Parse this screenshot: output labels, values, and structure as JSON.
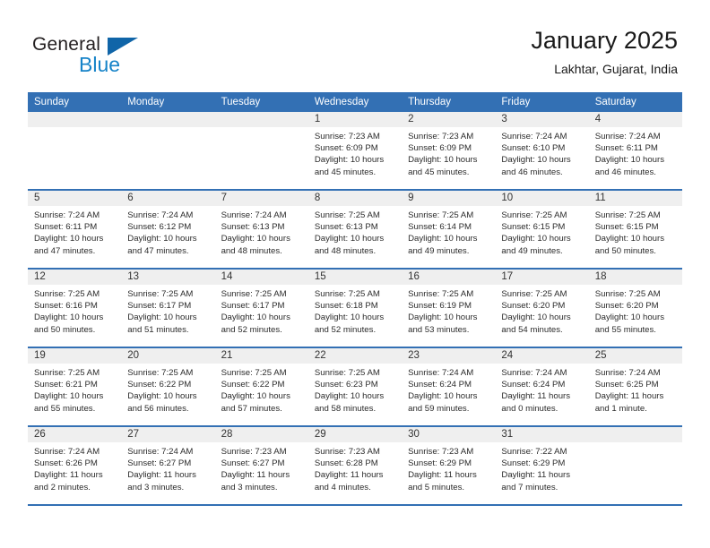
{
  "brand": {
    "name_dark": "General",
    "name_blue": "Blue",
    "color_dark": "#231f20",
    "color_blue": "#1683c8",
    "triangle_color": "#1065a8"
  },
  "header": {
    "title": "January 2025",
    "subtitle": "Lakhtar, Gujarat, India"
  },
  "theme": {
    "header_row_bg": "#3370b4",
    "header_row_text": "#ffffff",
    "daynum_band_bg": "#efefef",
    "row_divider": "#3370b4"
  },
  "calendar": {
    "weekday_headers": [
      "Sunday",
      "Monday",
      "Tuesday",
      "Wednesday",
      "Thursday",
      "Friday",
      "Saturday"
    ],
    "weeks": [
      [
        {
          "day": "",
          "empty": true
        },
        {
          "day": "",
          "empty": true
        },
        {
          "day": "",
          "empty": true
        },
        {
          "day": "1",
          "sunrise": "Sunrise: 7:23 AM",
          "sunset": "Sunset: 6:09 PM",
          "daylight_line1": "Daylight: 10 hours",
          "daylight_line2": "and 45 minutes."
        },
        {
          "day": "2",
          "sunrise": "Sunrise: 7:23 AM",
          "sunset": "Sunset: 6:09 PM",
          "daylight_line1": "Daylight: 10 hours",
          "daylight_line2": "and 45 minutes."
        },
        {
          "day": "3",
          "sunrise": "Sunrise: 7:24 AM",
          "sunset": "Sunset: 6:10 PM",
          "daylight_line1": "Daylight: 10 hours",
          "daylight_line2": "and 46 minutes."
        },
        {
          "day": "4",
          "sunrise": "Sunrise: 7:24 AM",
          "sunset": "Sunset: 6:11 PM",
          "daylight_line1": "Daylight: 10 hours",
          "daylight_line2": "and 46 minutes."
        }
      ],
      [
        {
          "day": "5",
          "sunrise": "Sunrise: 7:24 AM",
          "sunset": "Sunset: 6:11 PM",
          "daylight_line1": "Daylight: 10 hours",
          "daylight_line2": "and 47 minutes."
        },
        {
          "day": "6",
          "sunrise": "Sunrise: 7:24 AM",
          "sunset": "Sunset: 6:12 PM",
          "daylight_line1": "Daylight: 10 hours",
          "daylight_line2": "and 47 minutes."
        },
        {
          "day": "7",
          "sunrise": "Sunrise: 7:24 AM",
          "sunset": "Sunset: 6:13 PM",
          "daylight_line1": "Daylight: 10 hours",
          "daylight_line2": "and 48 minutes."
        },
        {
          "day": "8",
          "sunrise": "Sunrise: 7:25 AM",
          "sunset": "Sunset: 6:13 PM",
          "daylight_line1": "Daylight: 10 hours",
          "daylight_line2": "and 48 minutes."
        },
        {
          "day": "9",
          "sunrise": "Sunrise: 7:25 AM",
          "sunset": "Sunset: 6:14 PM",
          "daylight_line1": "Daylight: 10 hours",
          "daylight_line2": "and 49 minutes."
        },
        {
          "day": "10",
          "sunrise": "Sunrise: 7:25 AM",
          "sunset": "Sunset: 6:15 PM",
          "daylight_line1": "Daylight: 10 hours",
          "daylight_line2": "and 49 minutes."
        },
        {
          "day": "11",
          "sunrise": "Sunrise: 7:25 AM",
          "sunset": "Sunset: 6:15 PM",
          "daylight_line1": "Daylight: 10 hours",
          "daylight_line2": "and 50 minutes."
        }
      ],
      [
        {
          "day": "12",
          "sunrise": "Sunrise: 7:25 AM",
          "sunset": "Sunset: 6:16 PM",
          "daylight_line1": "Daylight: 10 hours",
          "daylight_line2": "and 50 minutes."
        },
        {
          "day": "13",
          "sunrise": "Sunrise: 7:25 AM",
          "sunset": "Sunset: 6:17 PM",
          "daylight_line1": "Daylight: 10 hours",
          "daylight_line2": "and 51 minutes."
        },
        {
          "day": "14",
          "sunrise": "Sunrise: 7:25 AM",
          "sunset": "Sunset: 6:17 PM",
          "daylight_line1": "Daylight: 10 hours",
          "daylight_line2": "and 52 minutes."
        },
        {
          "day": "15",
          "sunrise": "Sunrise: 7:25 AM",
          "sunset": "Sunset: 6:18 PM",
          "daylight_line1": "Daylight: 10 hours",
          "daylight_line2": "and 52 minutes."
        },
        {
          "day": "16",
          "sunrise": "Sunrise: 7:25 AM",
          "sunset": "Sunset: 6:19 PM",
          "daylight_line1": "Daylight: 10 hours",
          "daylight_line2": "and 53 minutes."
        },
        {
          "day": "17",
          "sunrise": "Sunrise: 7:25 AM",
          "sunset": "Sunset: 6:20 PM",
          "daylight_line1": "Daylight: 10 hours",
          "daylight_line2": "and 54 minutes."
        },
        {
          "day": "18",
          "sunrise": "Sunrise: 7:25 AM",
          "sunset": "Sunset: 6:20 PM",
          "daylight_line1": "Daylight: 10 hours",
          "daylight_line2": "and 55 minutes."
        }
      ],
      [
        {
          "day": "19",
          "sunrise": "Sunrise: 7:25 AM",
          "sunset": "Sunset: 6:21 PM",
          "daylight_line1": "Daylight: 10 hours",
          "daylight_line2": "and 55 minutes."
        },
        {
          "day": "20",
          "sunrise": "Sunrise: 7:25 AM",
          "sunset": "Sunset: 6:22 PM",
          "daylight_line1": "Daylight: 10 hours",
          "daylight_line2": "and 56 minutes."
        },
        {
          "day": "21",
          "sunrise": "Sunrise: 7:25 AM",
          "sunset": "Sunset: 6:22 PM",
          "daylight_line1": "Daylight: 10 hours",
          "daylight_line2": "and 57 minutes."
        },
        {
          "day": "22",
          "sunrise": "Sunrise: 7:25 AM",
          "sunset": "Sunset: 6:23 PM",
          "daylight_line1": "Daylight: 10 hours",
          "daylight_line2": "and 58 minutes."
        },
        {
          "day": "23",
          "sunrise": "Sunrise: 7:24 AM",
          "sunset": "Sunset: 6:24 PM",
          "daylight_line1": "Daylight: 10 hours",
          "daylight_line2": "and 59 minutes."
        },
        {
          "day": "24",
          "sunrise": "Sunrise: 7:24 AM",
          "sunset": "Sunset: 6:24 PM",
          "daylight_line1": "Daylight: 11 hours",
          "daylight_line2": "and 0 minutes."
        },
        {
          "day": "25",
          "sunrise": "Sunrise: 7:24 AM",
          "sunset": "Sunset: 6:25 PM",
          "daylight_line1": "Daylight: 11 hours",
          "daylight_line2": "and 1 minute."
        }
      ],
      [
        {
          "day": "26",
          "sunrise": "Sunrise: 7:24 AM",
          "sunset": "Sunset: 6:26 PM",
          "daylight_line1": "Daylight: 11 hours",
          "daylight_line2": "and 2 minutes."
        },
        {
          "day": "27",
          "sunrise": "Sunrise: 7:24 AM",
          "sunset": "Sunset: 6:27 PM",
          "daylight_line1": "Daylight: 11 hours",
          "daylight_line2": "and 3 minutes."
        },
        {
          "day": "28",
          "sunrise": "Sunrise: 7:23 AM",
          "sunset": "Sunset: 6:27 PM",
          "daylight_line1": "Daylight: 11 hours",
          "daylight_line2": "and 3 minutes."
        },
        {
          "day": "29",
          "sunrise": "Sunrise: 7:23 AM",
          "sunset": "Sunset: 6:28 PM",
          "daylight_line1": "Daylight: 11 hours",
          "daylight_line2": "and 4 minutes."
        },
        {
          "day": "30",
          "sunrise": "Sunrise: 7:23 AM",
          "sunset": "Sunset: 6:29 PM",
          "daylight_line1": "Daylight: 11 hours",
          "daylight_line2": "and 5 minutes."
        },
        {
          "day": "31",
          "sunrise": "Sunrise: 7:22 AM",
          "sunset": "Sunset: 6:29 PM",
          "daylight_line1": "Daylight: 11 hours",
          "daylight_line2": "and 7 minutes."
        },
        {
          "day": "",
          "empty": true
        }
      ]
    ]
  }
}
